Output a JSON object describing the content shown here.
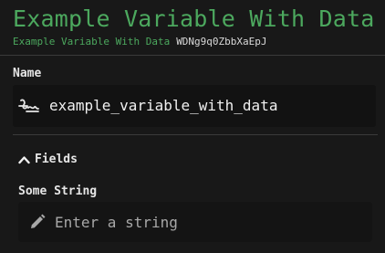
{
  "header": {
    "title": "Example Variable With Data",
    "subtitle": "Example Variable With Data",
    "id": "WDNg9q0ZbbXaEpJ"
  },
  "name_section": {
    "label": "Name",
    "value": "example_variable_with_data",
    "icon": "variable-icon"
  },
  "fields_section": {
    "toggle_label": "Fields",
    "toggle_icon": "chevron-up-icon",
    "fields": [
      {
        "label": "Some String",
        "placeholder": "Enter a string",
        "icon": "pencil-icon"
      }
    ]
  },
  "colors": {
    "accent": "#4ca85e",
    "background": "#181818",
    "input_background": "#141414"
  }
}
